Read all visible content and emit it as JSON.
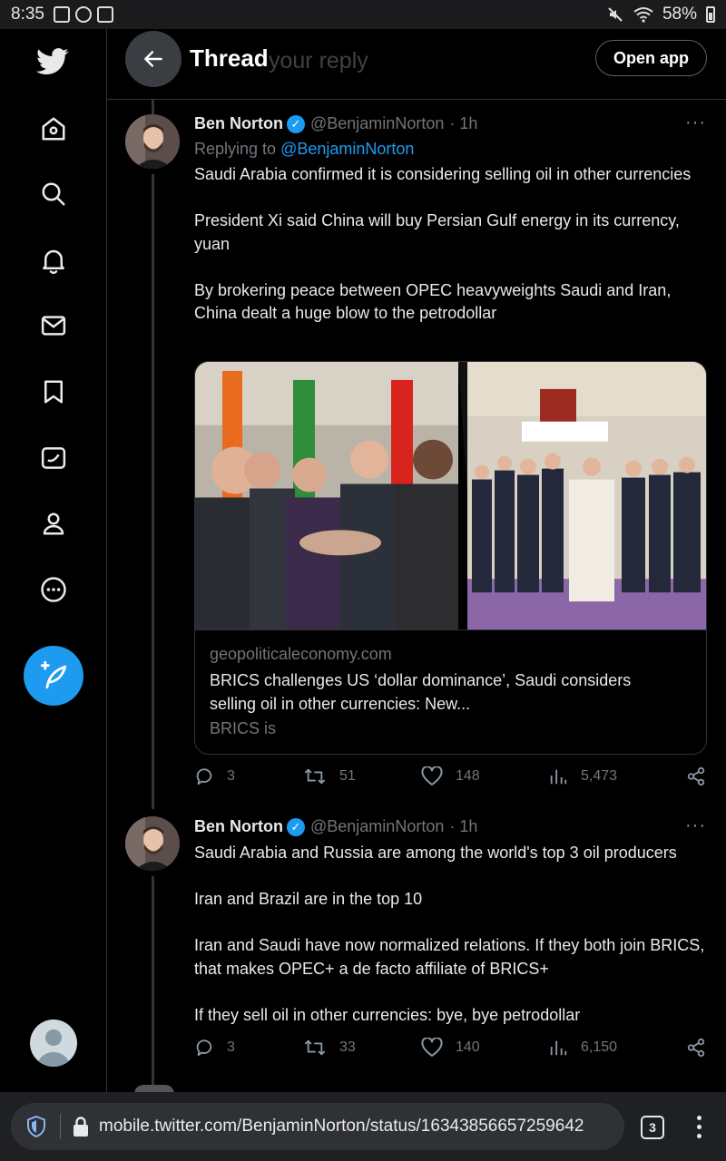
{
  "status_bar": {
    "time": "8:35",
    "battery": "58%"
  },
  "header": {
    "title": "Thread",
    "ghost_placeholder": "your reply",
    "open_app": "Open app"
  },
  "nav": {
    "items": [
      "Home",
      "Search",
      "Notifications",
      "Messages",
      "Bookmarks",
      "Twitter Blue",
      "Profile",
      "More"
    ],
    "compose": "Tweet"
  },
  "tweets": [
    {
      "name": "Ben Norton",
      "handle": "@BenjaminNorton",
      "time": "· 1h",
      "replying_label": "Replying to",
      "replying_to": "@BenjaminNorton",
      "text": "Saudi Arabia confirmed it is considering selling oil in other currencies\n\nPresident Xi said China will buy Persian Gulf energy in its currency, yuan\n\nBy brokering peace between OPEC heavyweights Saudi and Iran, China dealt a huge blow to the petrodollar",
      "card": {
        "domain": "geopoliticaleconomy.com",
        "title": "BRICS challenges US ‘dollar dominance’, Saudi considers selling oil in other currencies: New...",
        "description": "BRICS is"
      },
      "stats": {
        "replies": "3",
        "retweets": "51",
        "likes": "148",
        "views": "5,473"
      }
    },
    {
      "name": "Ben Norton",
      "handle": "@BenjaminNorton",
      "time": "· 1h",
      "text": "Saudi Arabia and Russia are among the world's top 3 oil producers\n\nIran and Brazil are in the top 10\n\nIran and Saudi have now normalized relations. If they both join BRICS, that makes OPEC+ a de facto affiliate of BRICS+\n\nIf they sell oil in other currencies: bye, bye petrodollar",
      "stats": {
        "replies": "3",
        "retweets": "33",
        "likes": "140",
        "views": "6,150"
      }
    }
  ],
  "browser": {
    "url": "mobile.twitter.com/BenjaminNorton/status/16343856657259642",
    "tab_count": "3"
  },
  "colors": {
    "accent": "#1d9bf0",
    "background": "#000000",
    "muted": "#71767b",
    "border": "#2f3336"
  }
}
